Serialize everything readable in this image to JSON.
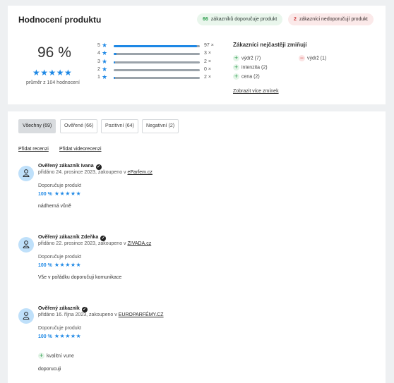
{
  "summary": {
    "title": "Hodnocení produktu",
    "positive_count": "66",
    "positive_label": "zákazníků doporučuje produkt",
    "negative_count": "2",
    "negative_label": "zákazníci nedoporučují produkt",
    "percent": "96 %",
    "stars": "★★★★★",
    "average_text": "průměr z 104 hodnocení",
    "rating_rows": [
      {
        "stars": "5",
        "count": "97 ×",
        "fraction": 0.97
      },
      {
        "stars": "4",
        "count": "3 ×",
        "fraction": 0.03
      },
      {
        "stars": "3",
        "count": "2 ×",
        "fraction": 0.02
      },
      {
        "stars": "2",
        "count": "0 ×",
        "fraction": 0.0
      },
      {
        "stars": "1",
        "count": "2 ×",
        "fraction": 0.02
      }
    ],
    "mentions_title": "Zákazníci nejčastěji zmiňují",
    "mentions": [
      {
        "label": "výdrž (7)",
        "type": "plus"
      },
      {
        "label": "intenzita (2)",
        "type": "plus"
      },
      {
        "label": "cena (2)",
        "type": "plus"
      },
      {
        "label": "výdrž (1)",
        "type": "minus"
      }
    ],
    "more_link": "Zobrazit více zmínek"
  },
  "reviews_section": {
    "tabs": [
      {
        "label": "Všechny (69)",
        "active": true
      },
      {
        "label": "Ověřené (66)",
        "active": false
      },
      {
        "label": "Pozitivní (64)",
        "active": false
      },
      {
        "label": "Negativní (2)",
        "active": false
      }
    ],
    "add_review": "Přidat recenzi",
    "add_video_review": "Přidat videorecenzi"
  },
  "reviews": [
    {
      "author": "Ověřený zákazník Ivana",
      "meta": "přidáno 24. prosince 2023, zakoupeno v",
      "shop": "eParfem.cz",
      "recommend": "Doporučuje produkt",
      "percent": "100 %",
      "stars": "★★★★★",
      "text": "nádherná vůně"
    },
    {
      "author": "Ověřený zákazník Zdeňka",
      "meta": "přidáno 22. prosince 2023, zakoupeno v",
      "shop": "ZIVADA.cz",
      "recommend": "Doporučuje produkt",
      "percent": "100 %",
      "stars": "★★★★★",
      "text": "Vše v pořádku doporučuji komunikace"
    },
    {
      "author": "Ověřený zákazník",
      "meta": "přidáno 16. října 2023, zakoupeno v",
      "shop": "EUROPARFÉMY.CZ",
      "recommend": "Doporučuje produkt",
      "percent": "100 %",
      "stars": "★★★★★",
      "pro": "kvalitní vune",
      "text": "doporucuji"
    }
  ],
  "colors": {
    "accent": "#1e88e5",
    "positive": "#2e9e4f",
    "negative": "#d04545"
  },
  "icons": {
    "star": "★",
    "plus": "+",
    "minus": "−",
    "verified": "check-badge-icon",
    "avatar": "user-icon"
  }
}
